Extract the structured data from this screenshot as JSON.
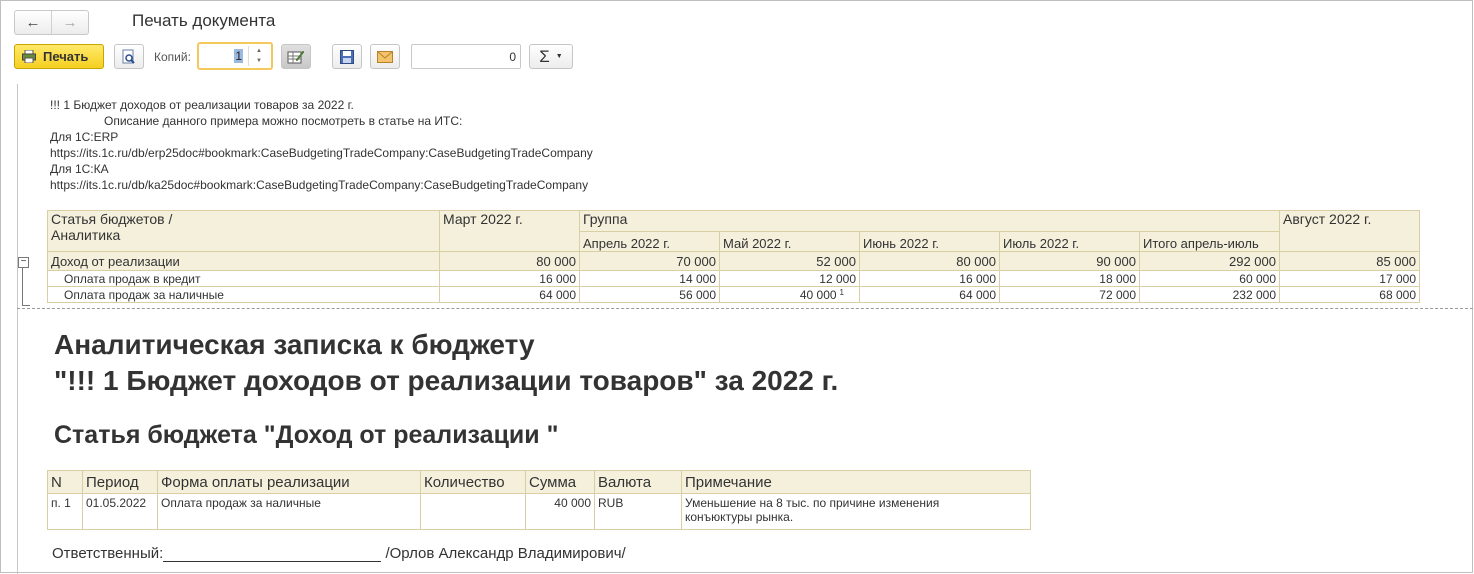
{
  "window": {
    "title": "Печать документа"
  },
  "toolbar": {
    "print_label": "Печать",
    "copies_label": "Копий:",
    "copies_value": "1",
    "counter_value": "0",
    "sum_label": "Σ"
  },
  "header_lines": [
    "!!! 1 Бюджет доходов от реализации товаров за 2022 г.",
    "Описание данного примера можно посмотреть в статье на ИТС:",
    "Для 1С:ERP",
    "https://its.1c.ru/db/erp25doc#bookmark:CaseBudgetingTradeCompany:CaseBudgetingTradeCompany",
    "Для 1С:КА",
    "https://its.1c.ru/db/ka25doc#bookmark:CaseBudgetingTradeCompany:CaseBudgetingTradeCompany"
  ],
  "budget_table": {
    "corner_line1": "Статья бюджетов /",
    "corner_line2": "Аналитика",
    "col_march": "Март 2022 г.",
    "group": "Группа",
    "col_april": "Апрель 2022 г.",
    "col_may": "Май 2022 г.",
    "col_june": "Июнь 2022 г.",
    "col_july": "Июль 2022 г.",
    "col_total": "Итого апрель-июль",
    "col_august": "Август 2022 г.",
    "rows": [
      {
        "name": "Доход от реализации",
        "v": [
          "80 000",
          "70 000",
          "52 000",
          "80 000",
          "90 000",
          "292 000",
          "85 000"
        ]
      },
      {
        "name": "Оплата продаж в кредит",
        "v": [
          "16 000",
          "14 000",
          "12 000",
          "16 000",
          "18 000",
          "60 000",
          "17 000"
        ]
      },
      {
        "name": "Оплата продаж за наличные",
        "v": [
          "64 000",
          "56 000",
          "40 000",
          "64 000",
          "72 000",
          "232 000",
          "68 000"
        ],
        "mark": "1"
      }
    ]
  },
  "report": {
    "title_line1": "Аналитическая записка к бюджету",
    "title_line2": "\"!!! 1 Бюджет доходов от реализации товаров\" за 2022 г.",
    "section": "Статья бюджета \"Доход от реализации \""
  },
  "note_table": {
    "headers": [
      "N",
      "Период",
      "Форма оплаты реализации",
      "Количество",
      "Сумма",
      "Валюта",
      "Примечание"
    ],
    "row": {
      "n": "п. 1",
      "period": "01.05.2022",
      "form": "Оплата продаж за наличные",
      "qty": "",
      "sum": "40 000",
      "currency": "RUB",
      "note1": "Уменьшение на 8 тыс. по причине изменения",
      "note2": "конъюктуры рынка."
    }
  },
  "signature": {
    "label": "Ответственный:",
    "name": "/Орлов Александр Владимирович/"
  },
  "colors": {
    "header_bg": "#f5f0dc",
    "print_button": "#f5cf21",
    "copies_border": "#f5c85c"
  }
}
